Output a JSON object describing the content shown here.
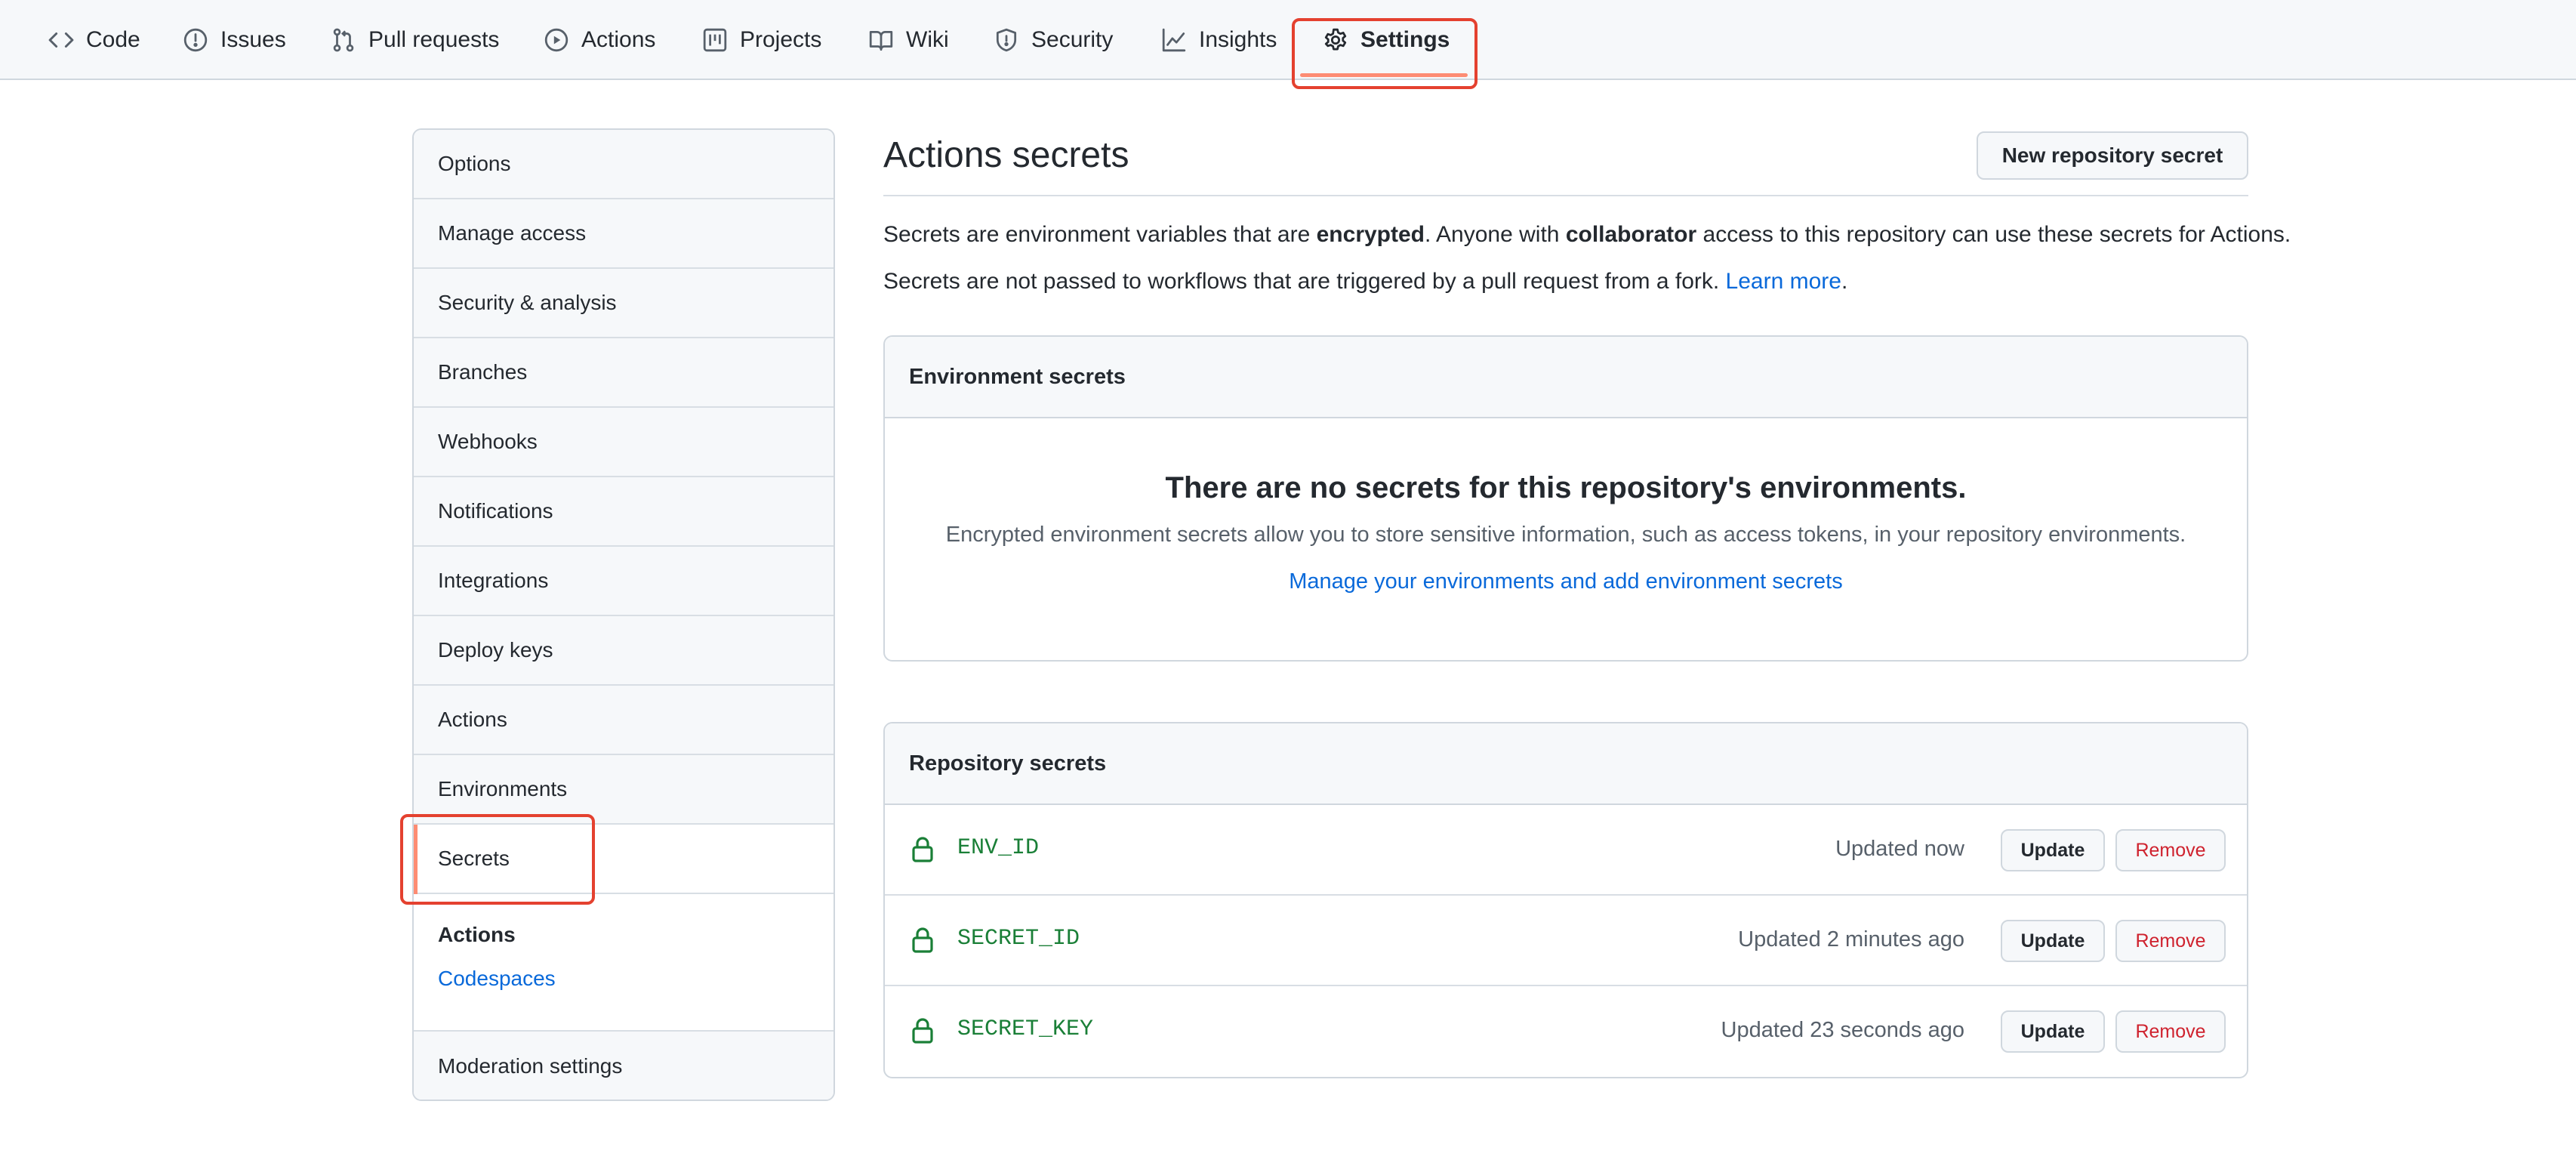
{
  "tabs": [
    {
      "label": "Code",
      "icon": "code-icon"
    },
    {
      "label": "Issues",
      "icon": "issue-icon"
    },
    {
      "label": "Pull requests",
      "icon": "pull-request-icon"
    },
    {
      "label": "Actions",
      "icon": "play-icon"
    },
    {
      "label": "Projects",
      "icon": "project-icon"
    },
    {
      "label": "Wiki",
      "icon": "book-icon"
    },
    {
      "label": "Security",
      "icon": "shield-icon"
    },
    {
      "label": "Insights",
      "icon": "graph-icon"
    },
    {
      "label": "Settings",
      "icon": "gear-icon",
      "selected": true
    }
  ],
  "sidebar": {
    "items": [
      {
        "label": "Options"
      },
      {
        "label": "Manage access"
      },
      {
        "label": "Security & analysis"
      },
      {
        "label": "Branches"
      },
      {
        "label": "Webhooks"
      },
      {
        "label": "Notifications"
      },
      {
        "label": "Integrations"
      },
      {
        "label": "Deploy keys"
      },
      {
        "label": "Actions"
      },
      {
        "label": "Environments"
      },
      {
        "label": "Secrets",
        "active": true
      }
    ],
    "sub_heading": "Actions",
    "sub_link": "Codespaces",
    "footer_item": "Moderation settings"
  },
  "main": {
    "title": "Actions secrets",
    "new_button": "New repository secret",
    "desc1": {
      "t1": "Secrets are environment variables that are ",
      "b1": "encrypted",
      "t2": ". Anyone with ",
      "b2": "collaborator",
      "t3": " access to this repository can use these secrets for Actions."
    },
    "desc2": {
      "t1": "Secrets are not passed to workflows that are triggered by a pull request from a fork. ",
      "link": "Learn more",
      "t2": "."
    },
    "environment_secrets": {
      "heading": "Environment secrets",
      "empty_title": "There are no secrets for this repository's environments.",
      "empty_text": "Encrypted environment secrets allow you to store sensitive information, such as access tokens, in your repository environments.",
      "empty_link": "Manage your environments and add environment secrets"
    },
    "repository_secrets": {
      "heading": "Repository secrets",
      "update_label": "Update",
      "remove_label": "Remove",
      "rows": [
        {
          "name": "ENV_ID",
          "updated": "Updated now"
        },
        {
          "name": "SECRET_ID",
          "updated": "Updated 2 minutes ago"
        },
        {
          "name": "SECRET_KEY",
          "updated": "Updated 23 seconds ago"
        }
      ]
    }
  },
  "colors": {
    "accent": "#fd8c73",
    "link": "#0969da",
    "secret_name": "#1a7f37",
    "danger": "#cf222e",
    "highlight": "#e4412f"
  }
}
